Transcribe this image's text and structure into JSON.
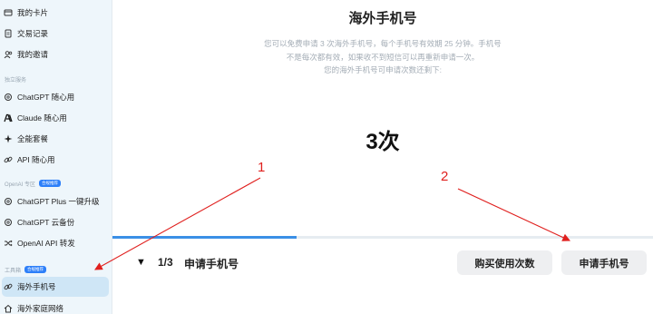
{
  "sidebar": {
    "items_top": [
      {
        "label": "我的卡片",
        "icon": "card-icon"
      },
      {
        "label": "交易记录",
        "icon": "receipt-icon"
      },
      {
        "label": "我的邀请",
        "icon": "users-icon"
      }
    ],
    "section_1": {
      "label": "独立服务"
    },
    "items_section_1": [
      {
        "label": "ChatGPT 随心用",
        "icon": "chatgpt-icon"
      },
      {
        "label": "Claude 随心用",
        "icon": "claude-icon"
      },
      {
        "label": "全能套餐",
        "icon": "sparkle-icon"
      },
      {
        "label": "API 随心用",
        "icon": "link-icon"
      }
    ],
    "section_2": {
      "label": "OpenAI 专区",
      "badge": "合规推荐"
    },
    "items_section_2": [
      {
        "label": "ChatGPT Plus 一键升级",
        "icon": "chatgpt-icon"
      },
      {
        "label": "ChatGPT 云备份",
        "icon": "chatgpt-icon"
      },
      {
        "label": "OpenAI API 转发",
        "icon": "shuffle-icon"
      }
    ],
    "section_3": {
      "label": "工具箱",
      "badge": "合规推荐"
    },
    "items_section_3": [
      {
        "label": "海外手机号",
        "icon": "link-icon",
        "active": true
      },
      {
        "label": "海外家庭网络",
        "icon": "home-icon"
      }
    ]
  },
  "main": {
    "title": "海外手机号",
    "desc_line1": "您可以免费申请 3 次海外手机号，每个手机号有效期 25 分钟。手机号",
    "desc_line2": "不是每次都有效，如果收不到短信可以再重新申请一次。",
    "desc_line3": "您的海外手机号可申请次数还剩下:",
    "remaining": "3次",
    "progress_fraction": 0.34
  },
  "step_bar": {
    "toggle": "▼",
    "step": "1/3",
    "step_name": "申请手机号",
    "buy_button": "购买使用次数",
    "apply_button": "申请手机号"
  },
  "annotations": {
    "label_1": "1",
    "label_2": "2",
    "color": "#e0201e"
  }
}
